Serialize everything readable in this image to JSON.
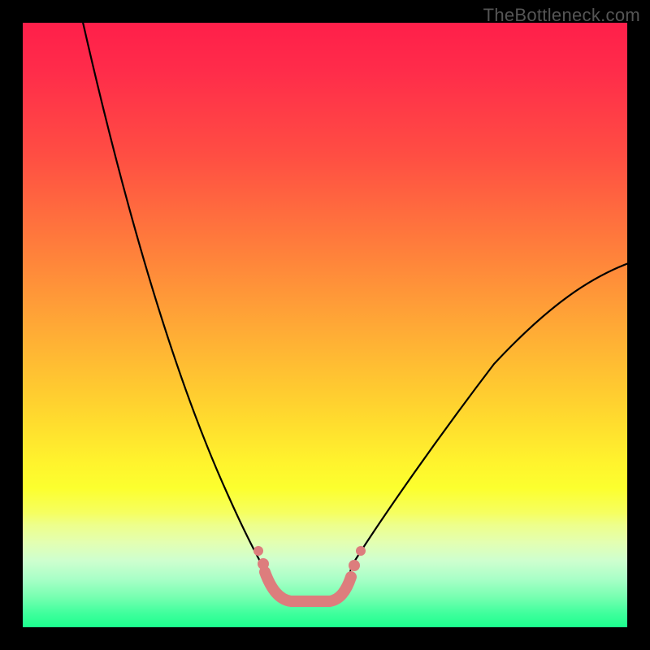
{
  "watermark": "TheBottleneck.com",
  "colors": {
    "frame": "#000000",
    "curve": "#000000",
    "flat_segment": "#d87a7a",
    "gradient_top": "#ff1f4a",
    "gradient_bottom": "#1bff8e"
  },
  "chart_data": {
    "type": "line",
    "title": "",
    "xlabel": "",
    "ylabel": "",
    "xlim": [
      0,
      100
    ],
    "ylim": [
      0,
      100
    ],
    "legend": false,
    "grid": false,
    "curve": {
      "left_branch": [
        {
          "x": 10,
          "y": 100
        },
        {
          "x": 40,
          "y": 8
        }
      ],
      "flat_segment": [
        {
          "x": 40,
          "y": 4
        },
        {
          "x": 53,
          "y": 4
        }
      ],
      "right_branch": [
        {
          "x": 53,
          "y": 8
        },
        {
          "x": 100,
          "y": 60
        }
      ],
      "flat_segment_style": "thick-coral-dotted"
    },
    "background_gradient": [
      {
        "pos": 0.0,
        "color": "#ff1f4a"
      },
      {
        "pos": 0.5,
        "color": "#ffa836"
      },
      {
        "pos": 0.77,
        "color": "#fcff2e"
      },
      {
        "pos": 1.0,
        "color": "#1bff8e"
      }
    ]
  }
}
